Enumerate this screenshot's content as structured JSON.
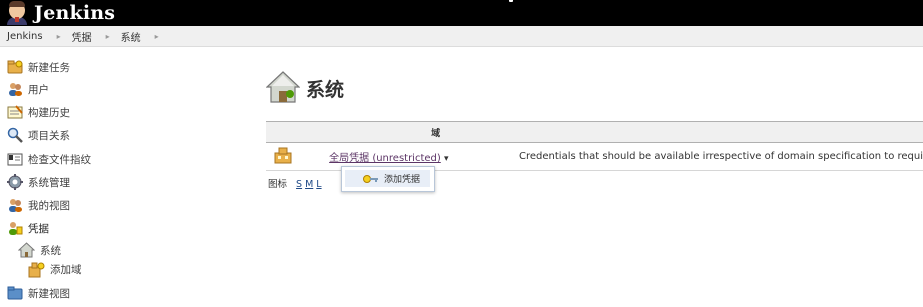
{
  "header": {
    "logo_text": "Jenkins"
  },
  "breadcrumbs": [
    "Jenkins",
    "凭据",
    "系统"
  ],
  "breadcrumb_separator": "▸",
  "sidebar": {
    "items": [
      {
        "label": "新建任务",
        "icon": "folder-add-icon"
      },
      {
        "label": "用户",
        "icon": "users-icon"
      },
      {
        "label": "构建历史",
        "icon": "notepad-icon"
      },
      {
        "label": "项目关系",
        "icon": "magnifier-icon"
      },
      {
        "label": "检查文件指纹",
        "icon": "fingerprint-icon"
      },
      {
        "label": "系统管理",
        "icon": "gear-icon"
      },
      {
        "label": "我的视图",
        "icon": "user-icon"
      },
      {
        "label": "凭据",
        "icon": "credentials-icon"
      },
      {
        "label": "系统",
        "icon": "home-icon"
      },
      {
        "label": "添加域",
        "icon": "domain-add-icon"
      },
      {
        "label": "新建视图",
        "icon": "folder-icon"
      }
    ]
  },
  "main": {
    "title": "系统",
    "title_icon": "system-home-icon",
    "table": {
      "header_domain": "域",
      "rows": [
        {
          "icon": "domain-icon",
          "name": "全局凭据 (unrestricted)",
          "caret": "▾",
          "description": "Credentials that should be available irrespective of domain specification to requi"
        }
      ]
    },
    "icon_size": {
      "label": "图标",
      "sizes": [
        "S",
        "M",
        "L"
      ]
    },
    "dropdown": {
      "item_label": "添加凭据",
      "item_icon": "key-icon"
    }
  },
  "colors": {
    "header_bg": "#000000",
    "breadcrumb_bg": "#f0f0f0",
    "link": "#5c3566",
    "dropdown_highlight": "#e8eef7"
  }
}
